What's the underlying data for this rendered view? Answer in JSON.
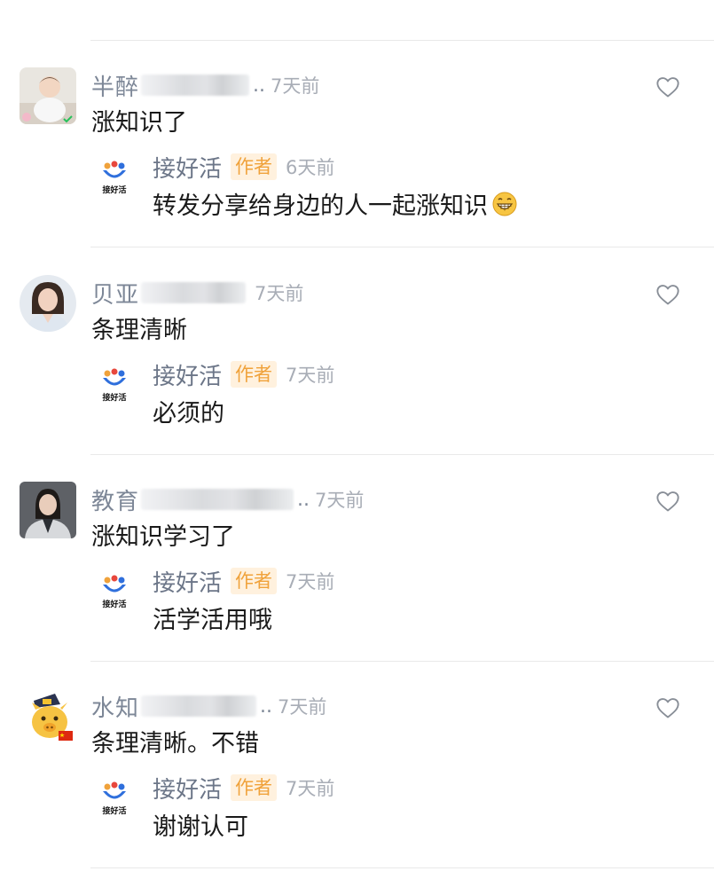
{
  "comments": [
    {
      "name": "半醉",
      "time": "7天前",
      "text": "涨知识了",
      "reply": {
        "name": "接好活",
        "tag": "作者",
        "time": "6天前",
        "text": "转发分享给身边的人一起涨知识",
        "emoji": "grinning-emoji"
      }
    },
    {
      "name": "贝亚",
      "time": "7天前",
      "text": "条理清晰",
      "reply": {
        "name": "接好活",
        "tag": "作者",
        "time": "7天前",
        "text": "必须的"
      }
    },
    {
      "name": "教育",
      "time": "7天前",
      "text": "涨知识学习了",
      "reply": {
        "name": "接好活",
        "tag": "作者",
        "time": "7天前",
        "text": "活学活用哦"
      }
    },
    {
      "name": "水知",
      "time": "7天前",
      "text": "条理清晰。不错",
      "reply": {
        "name": "接好活",
        "tag": "作者",
        "time": "7天前",
        "text": "谢谢认可"
      }
    }
  ],
  "logo_caption": "接好活",
  "ellipsis": "..",
  "colors": {
    "author_tag_bg": "#fff1de",
    "author_tag_text": "#f0a23b",
    "name": "#7d8797",
    "time": "#a8adb6"
  },
  "icons": {
    "like": "heart-outline-icon"
  }
}
